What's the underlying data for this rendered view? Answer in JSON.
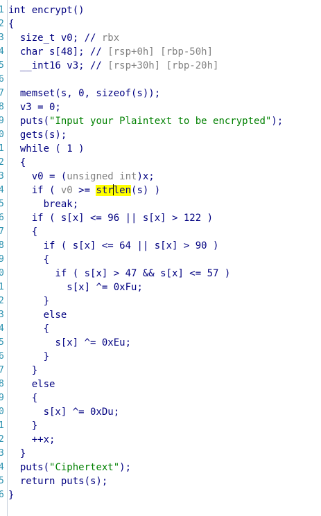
{
  "editor": {
    "line_numbers": [
      "1",
      "2",
      "3",
      "4",
      "5",
      "6",
      "7",
      "8",
      "9",
      "0",
      "1",
      "2",
      "3",
      "4",
      "5",
      "6",
      "7",
      "8",
      "9",
      "0",
      "1",
      "2",
      "3",
      "4",
      "5",
      "6",
      "7",
      "8",
      "9",
      "0",
      "1",
      "2",
      "3",
      "4",
      "5",
      "6"
    ],
    "lines": [
      {
        "indent": "",
        "parts": [
          {
            "t": "int encrypt()",
            "k": "p"
          }
        ]
      },
      {
        "indent": "",
        "parts": [
          {
            "t": "{",
            "k": "p"
          }
        ]
      },
      {
        "indent": "  ",
        "parts": [
          {
            "t": "size_t v0; // ",
            "k": "p"
          },
          {
            "t": "rbx",
            "k": "c"
          }
        ]
      },
      {
        "indent": "  ",
        "parts": [
          {
            "t": "char s[48]; // ",
            "k": "p"
          },
          {
            "t": "[rsp+0h] [rbp-50h]",
            "k": "c"
          }
        ]
      },
      {
        "indent": "  ",
        "parts": [
          {
            "t": "__int16 v3; // ",
            "k": "p"
          },
          {
            "t": "[rsp+30h] [rbp-20h]",
            "k": "c"
          }
        ]
      },
      {
        "indent": "",
        "parts": []
      },
      {
        "indent": "  ",
        "parts": [
          {
            "t": "memset(s, 0, sizeof(s));",
            "k": "p"
          }
        ]
      },
      {
        "indent": "  ",
        "parts": [
          {
            "t": "v3 = 0;",
            "k": "p"
          }
        ]
      },
      {
        "indent": "  ",
        "parts": [
          {
            "t": "puts(",
            "k": "p"
          },
          {
            "t": "\"Input your Plaintext to be encrypted\"",
            "k": "s"
          },
          {
            "t": ");",
            "k": "p"
          }
        ]
      },
      {
        "indent": "  ",
        "parts": [
          {
            "t": "gets(s);",
            "k": "p"
          }
        ]
      },
      {
        "indent": "  ",
        "parts": [
          {
            "t": "while ( 1 )",
            "k": "p"
          }
        ]
      },
      {
        "indent": "  ",
        "parts": [
          {
            "t": "{",
            "k": "p"
          }
        ]
      },
      {
        "indent": "    ",
        "parts": [
          {
            "t": "v0 = (",
            "k": "p"
          },
          {
            "t": "unsigned int",
            "k": "c"
          },
          {
            "t": ")x;",
            "k": "p"
          }
        ]
      },
      {
        "indent": "    ",
        "parts": [
          {
            "t": "if ( ",
            "k": "p"
          },
          {
            "t": "v0",
            "k": "c"
          },
          {
            "t": " >= ",
            "k": "p"
          },
          {
            "t": "str",
            "k": "h"
          },
          {
            "t": "",
            "k": "caret"
          },
          {
            "t": "len",
            "k": "h"
          },
          {
            "t": "(s) )",
            "k": "p"
          }
        ]
      },
      {
        "indent": "      ",
        "parts": [
          {
            "t": "break;",
            "k": "p"
          }
        ]
      },
      {
        "indent": "    ",
        "parts": [
          {
            "t": "if ( s[x] <= 96 || s[x] > 122 )",
            "k": "p"
          }
        ]
      },
      {
        "indent": "    ",
        "parts": [
          {
            "t": "{",
            "k": "p"
          }
        ]
      },
      {
        "indent": "      ",
        "parts": [
          {
            "t": "if ( s[x] <= 64 || s[x] > 90 )",
            "k": "p"
          }
        ]
      },
      {
        "indent": "      ",
        "parts": [
          {
            "t": "{",
            "k": "p"
          }
        ]
      },
      {
        "indent": "        ",
        "parts": [
          {
            "t": "if ( s[x] > 47 && s[x] <= 57 )",
            "k": "p"
          }
        ]
      },
      {
        "indent": "          ",
        "parts": [
          {
            "t": "s[x] ^= 0xFu;",
            "k": "p"
          }
        ]
      },
      {
        "indent": "      ",
        "parts": [
          {
            "t": "}",
            "k": "p"
          }
        ]
      },
      {
        "indent": "      ",
        "parts": [
          {
            "t": "else",
            "k": "p"
          }
        ]
      },
      {
        "indent": "      ",
        "parts": [
          {
            "t": "{",
            "k": "p"
          }
        ]
      },
      {
        "indent": "        ",
        "parts": [
          {
            "t": "s[x] ^= 0xEu;",
            "k": "p"
          }
        ]
      },
      {
        "indent": "      ",
        "parts": [
          {
            "t": "}",
            "k": "p"
          }
        ]
      },
      {
        "indent": "    ",
        "parts": [
          {
            "t": "}",
            "k": "p"
          }
        ]
      },
      {
        "indent": "    ",
        "parts": [
          {
            "t": "else",
            "k": "p"
          }
        ]
      },
      {
        "indent": "    ",
        "parts": [
          {
            "t": "{",
            "k": "p"
          }
        ]
      },
      {
        "indent": "      ",
        "parts": [
          {
            "t": "s[x] ^= 0xDu;",
            "k": "p"
          }
        ]
      },
      {
        "indent": "    ",
        "parts": [
          {
            "t": "}",
            "k": "p"
          }
        ]
      },
      {
        "indent": "    ",
        "parts": [
          {
            "t": "++x;",
            "k": "p"
          }
        ]
      },
      {
        "indent": "  ",
        "parts": [
          {
            "t": "}",
            "k": "p"
          }
        ]
      },
      {
        "indent": "  ",
        "parts": [
          {
            "t": "puts(",
            "k": "p"
          },
          {
            "t": "\"Ciphertext\"",
            "k": "s"
          },
          {
            "t": ");",
            "k": "p"
          }
        ]
      },
      {
        "indent": "  ",
        "parts": [
          {
            "t": "return puts(s);",
            "k": "p"
          }
        ]
      },
      {
        "indent": "",
        "parts": [
          {
            "t": "}",
            "k": "p"
          }
        ]
      }
    ]
  },
  "colors": {
    "code_text": "#000080",
    "comment_gray": "#808080",
    "string_green": "#008000",
    "highlight_yellow": "#ffff00",
    "line_number_blue": "#2b91af"
  }
}
